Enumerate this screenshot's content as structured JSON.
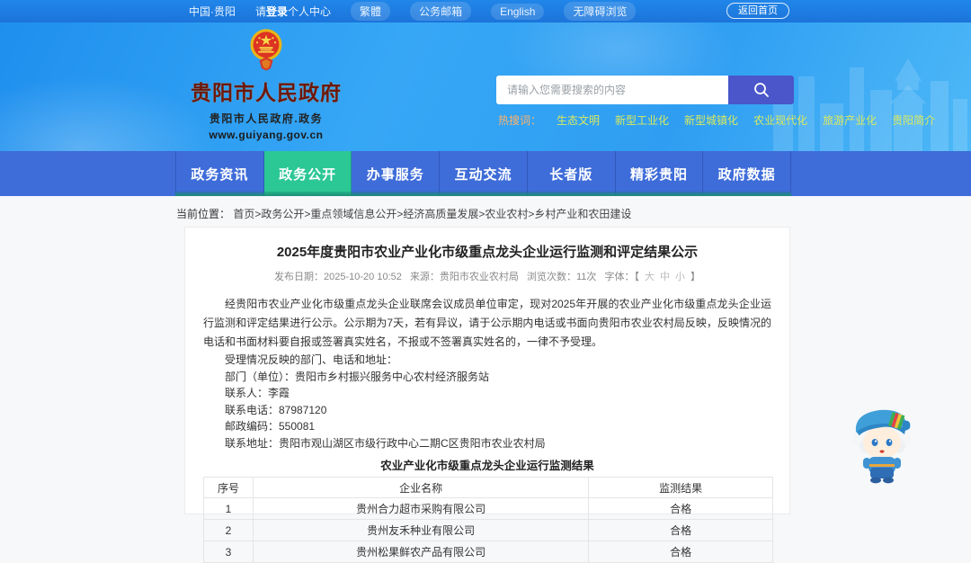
{
  "topbar": {
    "links": [
      "中国·贵阳",
      "繁體",
      "公务邮箱",
      "English",
      "无障碍浏览"
    ],
    "login": {
      "prefix": "请",
      "bold": "登录",
      "suffix": "个人中心"
    },
    "home_button": "返回首页"
  },
  "header": {
    "site_name": "贵阳市人民政府",
    "site_subtitle": "贵阳市人民政府.政务",
    "site_url": "www.guiyang.gov.cn",
    "search": {
      "placeholder": "请输入您需要搜索的内容"
    },
    "hot_search": {
      "label": "热搜词：",
      "terms": [
        "生态文明",
        "新型工业化",
        "新型城镇化",
        "农业现代化",
        "旅游产业化",
        "贵阳简介"
      ]
    }
  },
  "nav": {
    "items": [
      "政务资讯",
      "政务公开",
      "办事服务",
      "互动交流",
      "长者版",
      "精彩贵阳",
      "政府数据"
    ],
    "active_item": "政务公开"
  },
  "breadcrumb": {
    "label": "当前位置：",
    "path": "首页>政务公开>重点领域信息公开>经济高质量发展>农业农村>乡村产业和农田建设"
  },
  "article": {
    "title": "2025年度贵阳市农业产业化市级重点龙头企业运行监测和评定结果公示",
    "meta": {
      "publish": "发布日期：2025-10-20 10:52",
      "source": "来源：贵阳市农业农村局",
      "views": "浏览次数：11次",
      "font_label": "字体：【",
      "font_sizes": [
        "大",
        "中",
        "小"
      ],
      "font_close": "】"
    },
    "paragraphs": [
      "经贵阳市农业产业化市级重点龙头企业联席会议成员单位审定，现对2025年开展的农业产业化市级重点龙头企业运行监测和评定结果进行公示。公示期为7天，若有异议，请于公示期内电话或书面向贵阳市农业农村局反映，反映情况的电话和书面材料要自报或签署真实姓名，不报或不签署真实姓名的，一律不予受理。",
      "受理情况反映的部门、电话和地址：",
      "部门（单位）：贵阳市乡村振兴服务中心农村经济服务站",
      "联系人：李霞",
      "联系电话：87987120",
      "邮政编码：550081",
      "联系地址：贵阳市观山湖区市级行政中心二期C区贵阳市农业农村局"
    ],
    "table": {
      "caption": "农业产业化市级重点龙头企业运行监测结果",
      "headers": [
        "序号",
        "企业名称",
        "监测结果"
      ],
      "rows": [
        {
          "no": "1",
          "name": "贵州合力超市采购有限公司",
          "result": "合格"
        },
        {
          "no": "2",
          "name": "贵州友禾种业有限公司",
          "result": "合格"
        },
        {
          "no": "3",
          "name": "贵州松果鲜农产品有限公司",
          "result": "合格"
        }
      ]
    }
  },
  "icons": {
    "search": "search-icon",
    "emblem": "national-emblem-icon",
    "mascot": "mascot-character"
  },
  "colors": {
    "topbar_blue": "#1b74da",
    "banner_blue": "#36a7f5",
    "nav_blue": "#3e6cd9",
    "active_tab_green": "#2bc795",
    "search_button_indigo": "#4a56c9",
    "hot_label_orange": "#ffb36b",
    "hot_term_yellow": "#d8e95f",
    "site_name_maroon": "#6d170c"
  }
}
